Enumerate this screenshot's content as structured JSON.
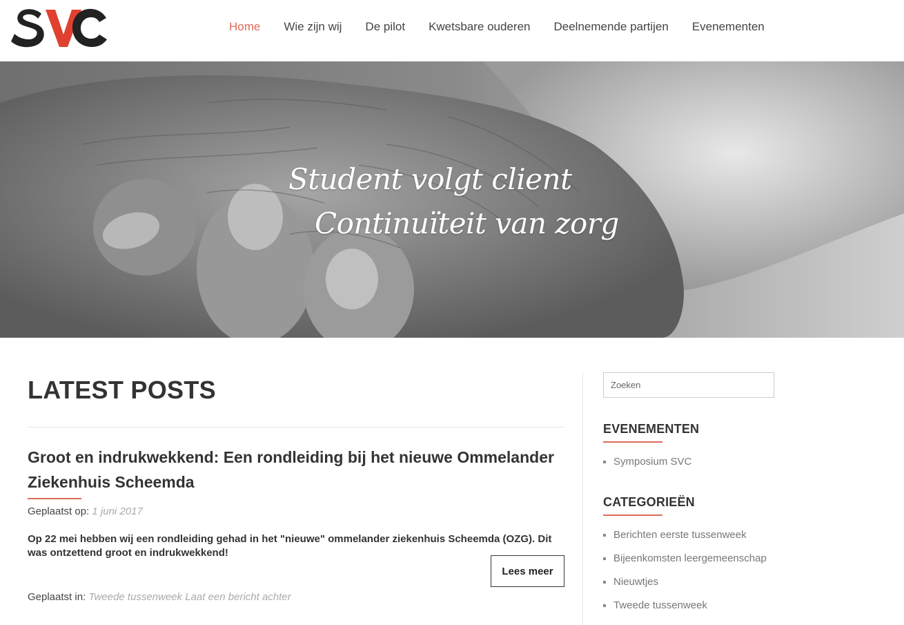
{
  "brand": {
    "logo_text": "SVC",
    "logo_colors": {
      "s": "#222222",
      "v": "#e0412e",
      "c": "#222222"
    }
  },
  "nav": {
    "items": [
      {
        "label": "Home",
        "active": true
      },
      {
        "label": "Wie zijn wij",
        "active": false
      },
      {
        "label": "De pilot",
        "active": false
      },
      {
        "label": "Kwetsbare ouderen",
        "active": false
      },
      {
        "label": "Deelnemende partijen",
        "active": false
      },
      {
        "label": "Evenementen",
        "active": false
      }
    ]
  },
  "hero": {
    "line1": "Student volgt client",
    "line2": "Continuïteit van zorg",
    "image": "grayscale-holding-hands-photo"
  },
  "main": {
    "section_title": "LATEST POSTS",
    "post": {
      "title": "Groot en indrukwekkend: Een rondleiding bij het nieuwe Ommelander Ziekenhuis Scheemda",
      "posted_on_label": "Geplaatst op:",
      "date": "1 juni 2017",
      "excerpt": "Op 22 mei hebben wij een rondleiding gehad in het \"nieuwe\" ommelander ziekenhuis Scheemda (OZG). Dit was ontzettend groot en indrukwekkend!",
      "read_more": "Lees meer",
      "posted_in_label": "Geplaatst in:",
      "category": "Tweede tussenweek",
      "comment_link": "Laat een bericht achter"
    }
  },
  "sidebar": {
    "search_placeholder": "Zoeken",
    "events": {
      "title": "EVENEMENTEN",
      "items": [
        "Symposium SVC"
      ]
    },
    "categories": {
      "title": "CATEGORIEËN",
      "items": [
        "Berichten eerste tussenweek",
        "Bijeenkomsten leergemeenschap",
        "Nieuwtjes",
        "Tweede tussenweek"
      ]
    }
  },
  "colors": {
    "accent": "#e06a5a",
    "text": "#333333",
    "muted": "#aaaaaa"
  }
}
